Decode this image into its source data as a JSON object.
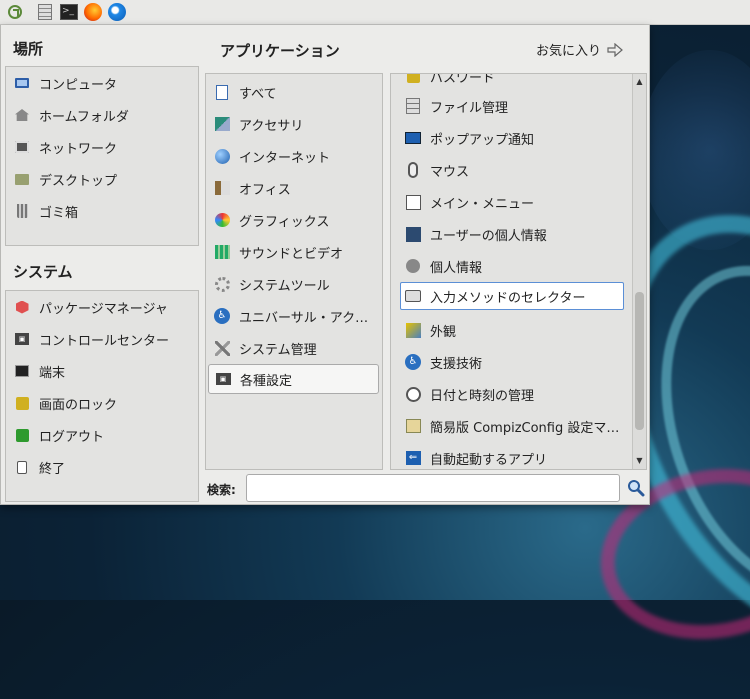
{
  "panel": {
    "launchers": [
      {
        "name": "mint-menu",
        "icon": "mint-logo-icon"
      },
      {
        "name": "file-manager",
        "icon": "file-cabinet-icon"
      },
      {
        "name": "terminal",
        "icon": "terminal-icon"
      },
      {
        "name": "firefox",
        "icon": "firefox-icon"
      },
      {
        "name": "thunderbird",
        "icon": "thunderbird-icon"
      }
    ]
  },
  "places": {
    "title": "場所",
    "items": [
      {
        "label": "コンピュータ",
        "icon": "computer-icon"
      },
      {
        "label": "ホームフォルダ",
        "icon": "home-folder-icon"
      },
      {
        "label": "ネットワーク",
        "icon": "network-icon"
      },
      {
        "label": "デスクトップ",
        "icon": "desktop-folder-icon"
      },
      {
        "label": "ゴミ箱",
        "icon": "trash-icon"
      }
    ]
  },
  "system": {
    "title": "システム",
    "items": [
      {
        "label": "パッケージマネージャ",
        "icon": "package-icon"
      },
      {
        "label": "コントロールセンター",
        "icon": "control-center-icon"
      },
      {
        "label": "端末",
        "icon": "terminal-icon"
      },
      {
        "label": "画面のロック",
        "icon": "lock-icon"
      },
      {
        "label": "ログアウト",
        "icon": "logout-icon"
      },
      {
        "label": "終了",
        "icon": "quit-icon"
      }
    ]
  },
  "applications": {
    "title": "アプリケーション",
    "favorites_label": "お気に入り",
    "categories": [
      {
        "label": "すべて",
        "icon": "all-apps-icon"
      },
      {
        "label": "アクセサリ",
        "icon": "accessories-icon"
      },
      {
        "label": "インターネット",
        "icon": "internet-globe-icon"
      },
      {
        "label": "オフィス",
        "icon": "office-icon"
      },
      {
        "label": "グラフィックス",
        "icon": "graphics-palette-icon"
      },
      {
        "label": "サウンドとビデオ",
        "icon": "sound-video-icon"
      },
      {
        "label": "システムツール",
        "icon": "system-tools-icon"
      },
      {
        "label": "ユニバーサル・アク…",
        "icon": "universal-access-icon"
      },
      {
        "label": "システム管理",
        "icon": "administration-icon"
      },
      {
        "label": "各種設定",
        "icon": "preferences-icon",
        "selected": true
      }
    ],
    "apps": [
      {
        "label": "パスワード",
        "icon": "passwords-icon"
      },
      {
        "label": "ファイル管理",
        "icon": "file-management-icon"
      },
      {
        "label": "ポップアップ通知",
        "icon": "popup-notification-icon"
      },
      {
        "label": "マウス",
        "icon": "mouse-icon"
      },
      {
        "label": "メイン・メニュー",
        "icon": "main-menu-editor-icon"
      },
      {
        "label": "ユーザーの個人情報",
        "icon": "user-info-icon"
      },
      {
        "label": "個人情報",
        "icon": "personal-info-icon"
      },
      {
        "label": "入力メソッドのセレクター",
        "icon": "input-method-icon",
        "focused": true
      },
      {
        "label": "外観",
        "icon": "appearance-icon"
      },
      {
        "label": "支援技術",
        "icon": "assistive-tech-icon"
      },
      {
        "label": "日付と時刻の管理",
        "icon": "clock-icon"
      },
      {
        "label": "簡易版 CompizConfig 設定マ…",
        "icon": "compizconfig-icon"
      },
      {
        "label": "自動起動するアプリ",
        "icon": "startup-apps-icon"
      }
    ]
  },
  "search": {
    "label": "検索:",
    "value": "",
    "placeholder": ""
  }
}
